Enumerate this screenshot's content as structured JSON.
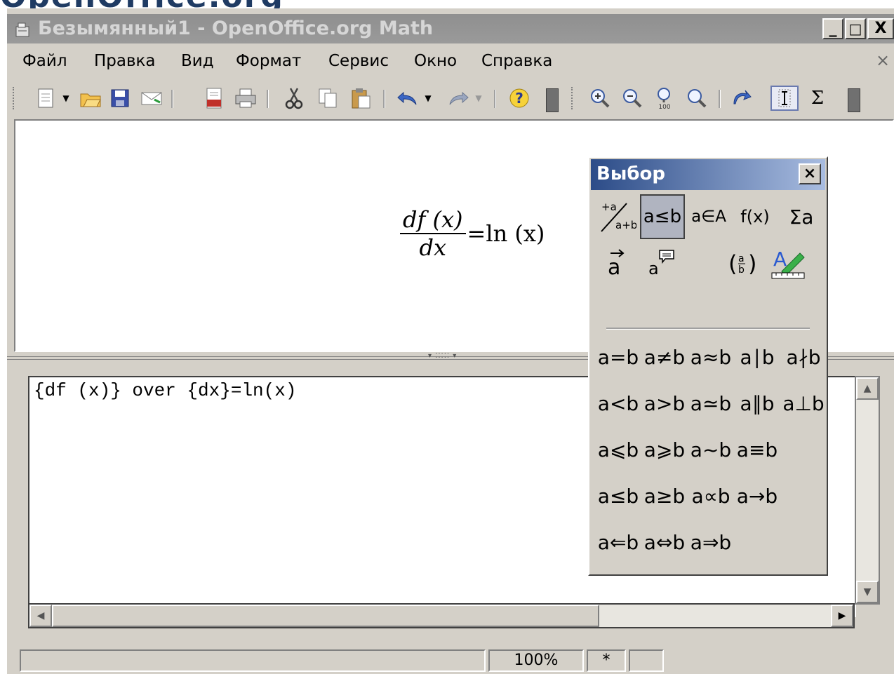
{
  "banner": {
    "text": "OpenOffice.org"
  },
  "window": {
    "title": "Безымянный1 - OpenOffice.org Math",
    "controls": {
      "minimize": "_",
      "maximize": "□",
      "close": "X"
    }
  },
  "menubar": {
    "items": [
      {
        "label": "Файл",
        "underline": "Ф"
      },
      {
        "label": "Правка",
        "underline": "П"
      },
      {
        "label": "Вид",
        "underline": "В"
      },
      {
        "label": "Формат",
        "underline": "р"
      },
      {
        "label": "Сервис",
        "underline": "е"
      },
      {
        "label": "Окно",
        "underline": "О"
      },
      {
        "label": "Справка",
        "underline": "а"
      }
    ],
    "doc_close": "×"
  },
  "toolbar": {
    "icons": [
      "new-document-icon",
      "dropdown-arrow-icon",
      "open-folder-icon",
      "save-icon",
      "email-icon",
      "export-pdf-icon",
      "print-icon",
      "cut-icon",
      "copy-icon",
      "paste-icon",
      "undo-icon",
      "redo-icon",
      "help-icon",
      "zoom-in-icon",
      "zoom-out-icon",
      "zoom-100-icon",
      "zoom-fit-icon",
      "update-icon",
      "formula-cursor-icon",
      "sigma-icon"
    ],
    "sigma": "Σ"
  },
  "preview": {
    "formula": {
      "numerator": "df (x)",
      "denominator": "dx",
      "rhs": "=ln (x)"
    }
  },
  "editor": {
    "text": "{df (x)} over {dx}=ln(x)"
  },
  "statusbar": {
    "zoom": "100%",
    "modified": "*"
  },
  "selection_panel": {
    "title": "Выбор",
    "close": "×",
    "categories": [
      {
        "name": "unary-binary-operators-icon",
        "label": "+a/a+b"
      },
      {
        "name": "relations-icon",
        "label": "a≤b",
        "selected": true
      },
      {
        "name": "set-operations-icon",
        "label": "a∈A"
      },
      {
        "name": "functions-icon",
        "label": "f(x)"
      },
      {
        "name": "operators-icon",
        "label": "Σa"
      },
      {
        "name": "attributes-icon",
        "label": "a⃗"
      },
      {
        "name": "others-icon",
        "label": "a💬"
      },
      {
        "name": "brackets-icon",
        "label": "(a/b)"
      },
      {
        "name": "formats-icon",
        "label": "A"
      }
    ],
    "operators": [
      [
        "a=b",
        "a≠b",
        "a≈b",
        "a∣b",
        "a∤b"
      ],
      [
        "a<b",
        "a>b",
        "a≃b",
        "a∥b",
        "a⊥b"
      ],
      [
        "a⩽b",
        "a⩾b",
        "a~b",
        "a≡b"
      ],
      [
        "a≤b",
        "a≥b",
        "a∝b",
        "a→b"
      ],
      [
        "a⇐b",
        "a⇔b",
        "a⇒b"
      ]
    ]
  },
  "colors": {
    "banner": "#1f3b63",
    "titlebar": "#999999",
    "panel_title": "#2c4c88",
    "chrome": "#d4d0c8"
  }
}
